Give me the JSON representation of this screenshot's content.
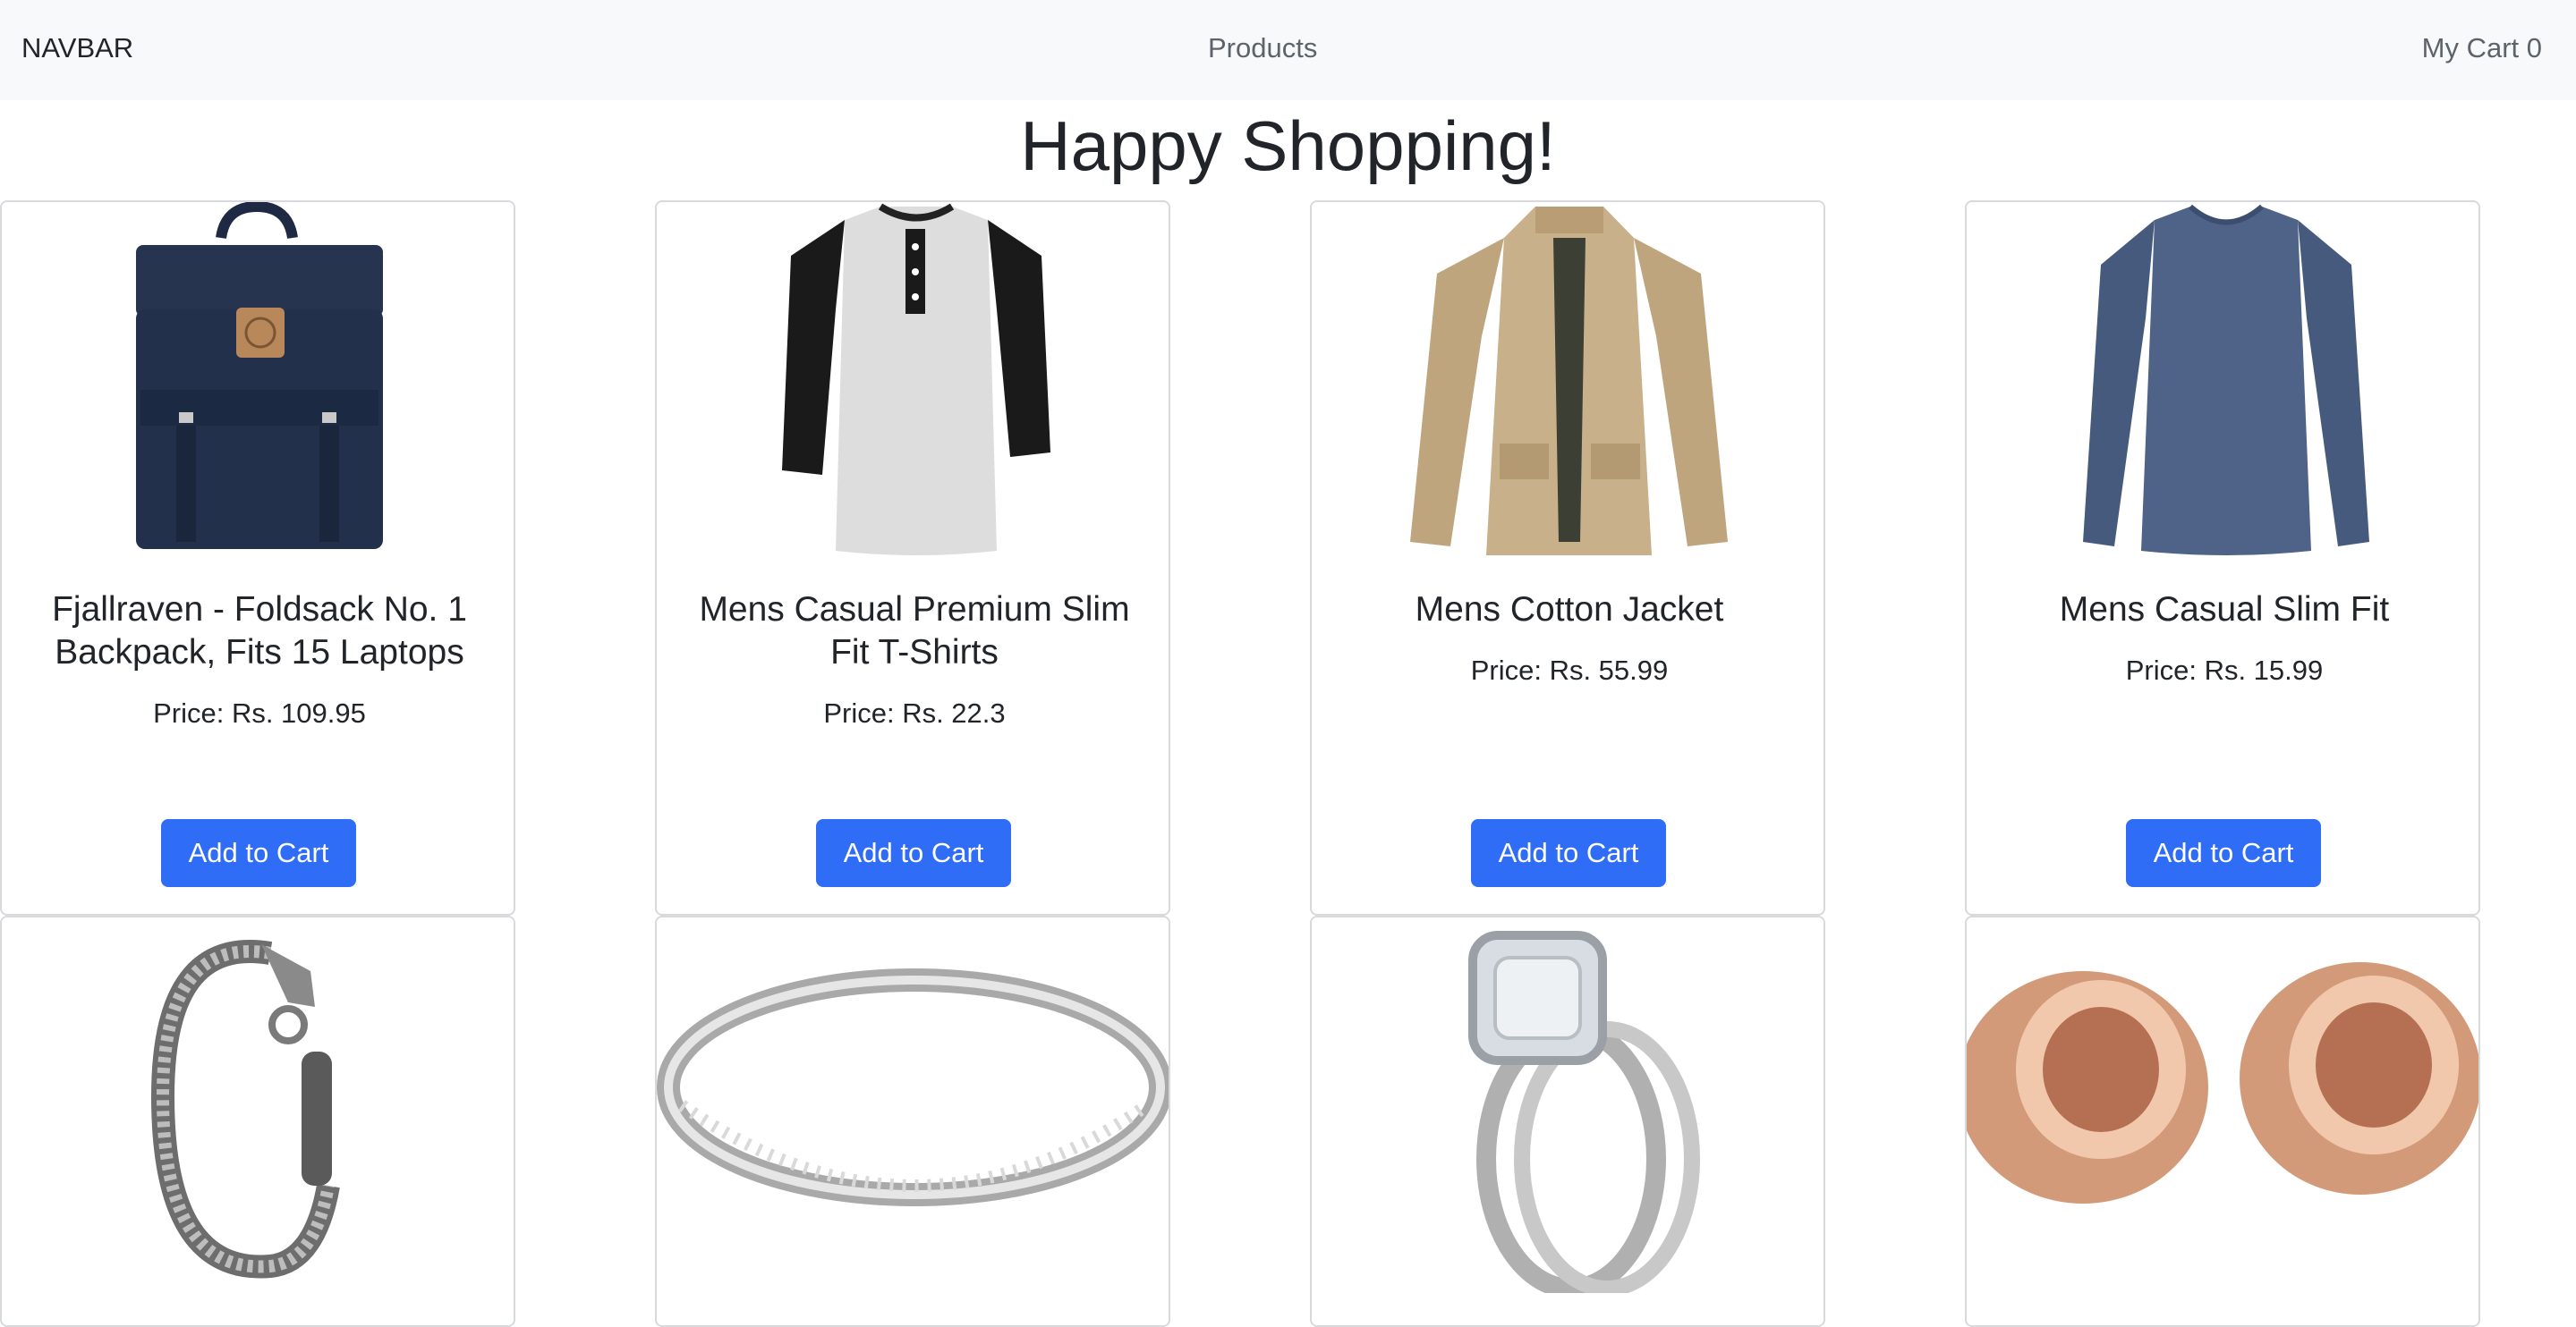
{
  "navbar": {
    "brand": "NAVBAR",
    "products_link": "Products",
    "cart_link": "My Cart 0"
  },
  "heading": "Happy Shopping!",
  "products": [
    {
      "title": "Fjallraven - Foldsack No. 1 Backpack, Fits 15 Laptops",
      "price": "Price: Rs. 109.95",
      "button": "Add to Cart",
      "image": "navy-backpack"
    },
    {
      "title": "Mens Casual Premium Slim Fit T-Shirts",
      "price": "Price: Rs. 22.3",
      "button": "Add to Cart",
      "image": "raglan-tshirt"
    },
    {
      "title": "Mens Cotton Jacket",
      "price": "Price: Rs. 55.99",
      "button": "Add to Cart",
      "image": "khaki-jacket"
    },
    {
      "title": "Mens Casual Slim Fit",
      "price": "Price: Rs. 15.99",
      "button": "Add to Cart",
      "image": "blue-longsleeve"
    },
    {
      "image": "silver-dragon-bracelet"
    },
    {
      "image": "silver-band-ring"
    },
    {
      "image": "diamond-ring-set"
    },
    {
      "image": "rose-gold-plugs"
    }
  ],
  "colors": {
    "navbar_bg": "#f8f9fa",
    "button_bg": "#2f6df6",
    "card_border": "#d7d9dc"
  }
}
